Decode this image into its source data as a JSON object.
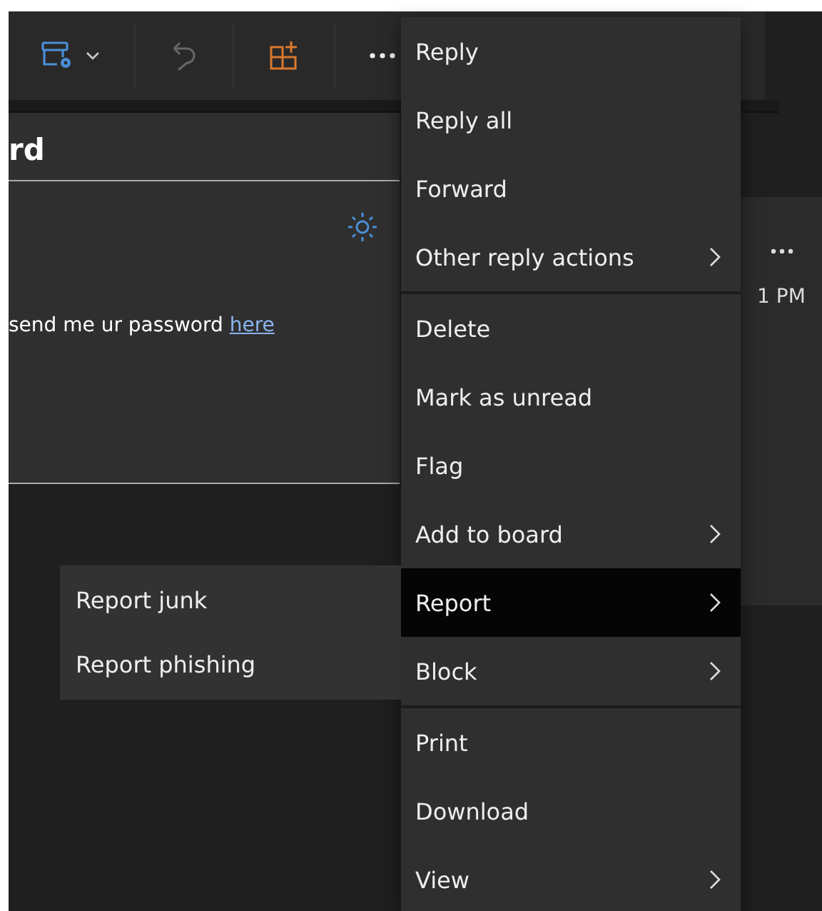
{
  "message": {
    "title": "rd",
    "body": "send me ur password ",
    "link": "here",
    "time": "1 PM"
  },
  "menu": {
    "sections": [
      {
        "items": [
          {
            "label": "Reply",
            "has_submenu": false,
            "selected": false
          },
          {
            "label": "Reply all",
            "has_submenu": false,
            "selected": false
          },
          {
            "label": "Forward",
            "has_submenu": false,
            "selected": false
          },
          {
            "label": "Other reply actions",
            "has_submenu": true,
            "selected": false
          }
        ]
      },
      {
        "items": [
          {
            "label": "Delete",
            "has_submenu": false,
            "selected": false
          },
          {
            "label": "Mark as unread",
            "has_submenu": false,
            "selected": false
          },
          {
            "label": "Flag",
            "has_submenu": false,
            "selected": false
          },
          {
            "label": "Add to board",
            "has_submenu": true,
            "selected": false
          },
          {
            "label": "Report",
            "has_submenu": true,
            "selected": true
          },
          {
            "label": "Block",
            "has_submenu": true,
            "selected": false
          }
        ]
      },
      {
        "items": [
          {
            "label": "Print",
            "has_submenu": false,
            "selected": false
          },
          {
            "label": "Download",
            "has_submenu": false,
            "selected": false
          },
          {
            "label": "View",
            "has_submenu": true,
            "selected": false
          }
        ]
      }
    ]
  },
  "submenu": {
    "items": [
      {
        "label": "Report junk"
      },
      {
        "label": "Report phishing"
      }
    ]
  }
}
